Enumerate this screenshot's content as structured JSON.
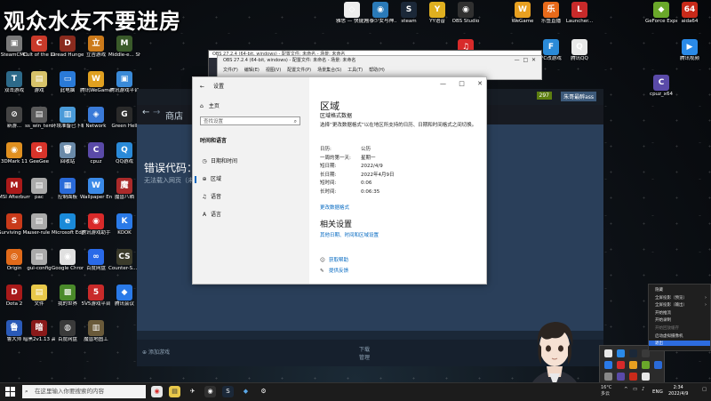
{
  "overlay": {
    "title": "观众水友不要进房"
  },
  "desktop_left": [
    {
      "label": "SteamCMD",
      "color": "#7a7a7a",
      "glyph": "▣"
    },
    {
      "label": "Cult of the Lamb 1.1.13 ...",
      "color": "#c93a2a",
      "glyph": "C"
    },
    {
      "label": "Dread Hunger",
      "color": "#8a2b1e",
      "glyph": "D"
    },
    {
      "label": "立吉游戏",
      "color": "#cc7a1a",
      "glyph": "立"
    },
    {
      "label": "Middle-e... Shadow of...",
      "color": "#3a5a2a",
      "glyph": "M"
    },
    {
      "label": "双击游戏",
      "color": "#2d6a8a",
      "glyph": "T"
    },
    {
      "label": "游戏",
      "color": "#d8c36a",
      "glyph": "▤"
    },
    {
      "label": "此电脑",
      "color": "#2a7ad8",
      "glyph": "▭"
    },
    {
      "label": "腾讯WeGame",
      "color": "#e0a020",
      "glyph": "W"
    },
    {
      "label": "腾讯游戏平台",
      "color": "#3a8ad8",
      "glyph": "▣"
    },
    {
      "label": "新游...",
      "color": "#444",
      "glyph": "⊘"
    },
    {
      "label": "ss_win_tem",
      "color": "#5a5a5a",
      "glyph": "▤"
    },
    {
      "label": "环境准备已下载的...",
      "color": "#4a9ad8",
      "glyph": "▥"
    },
    {
      "label": "Network",
      "color": "#3a7ad8",
      "glyph": "◈"
    },
    {
      "label": "Green Hell",
      "color": "#2a2a2a",
      "glyph": "G"
    },
    {
      "label": "3DMark 11",
      "color": "#e09020",
      "glyph": "◉"
    },
    {
      "label": "GeeGee",
      "color": "#d8342a",
      "glyph": "G"
    },
    {
      "label": "回收站",
      "color": "#6a8aa8",
      "glyph": "🗑"
    },
    {
      "label": "cpuz",
      "color": "#5a4aa8",
      "glyph": "C"
    },
    {
      "label": "QQ游戏",
      "color": "#2a8ad8",
      "glyph": "Q"
    },
    {
      "label": "MSI Afterburner",
      "color": "#aa1a1a",
      "glyph": "M"
    },
    {
      "label": "pac",
      "color": "#aaaaaa",
      "glyph": "▤"
    },
    {
      "label": "控制面板",
      "color": "#2a6ad8",
      "glyph": "▦"
    },
    {
      "label": "Wallpaper Engine",
      "color": "#3a8ae8",
      "glyph": "W"
    },
    {
      "label": "魔兽八晒",
      "color": "#aa2a2a",
      "glyph": "魔"
    },
    {
      "label": "Surviving Mars",
      "color": "#c83a1a",
      "glyph": "S"
    },
    {
      "label": "user-rule",
      "color": "#aaaaaa",
      "glyph": "▤"
    },
    {
      "label": "Microsoft Edge",
      "color": "#1a8ad8",
      "glyph": "e"
    },
    {
      "label": "腾讯游戏助手",
      "color": "#d82a2a",
      "glyph": "◉"
    },
    {
      "label": "KOOK",
      "color": "#2a7ae8",
      "glyph": "K"
    },
    {
      "label": "Origin",
      "color": "#e06a1a",
      "glyph": "◎"
    },
    {
      "label": "gui-config",
      "color": "#aaaaaa",
      "glyph": "▤"
    },
    {
      "label": "Google Chrome",
      "color": "#e0e0e0",
      "glyph": "◉"
    },
    {
      "label": "百度网盘",
      "color": "#2a6ae8",
      "glyph": "∞"
    },
    {
      "label": "Counter-S... Global Off...",
      "color": "#3a3a2a",
      "glyph": "CS"
    },
    {
      "label": "Dota 2",
      "color": "#a81a1a",
      "glyph": "D"
    },
    {
      "label": "文件",
      "color": "#e8c84a",
      "glyph": "▤"
    },
    {
      "label": "我的世界",
      "color": "#4a8a2a",
      "glyph": "▩"
    },
    {
      "label": "5V5游戏平台",
      "color": "#c82a2a",
      "glyph": "5"
    },
    {
      "label": "腾讯会议",
      "color": "#2a7ae8",
      "glyph": "◆"
    },
    {
      "label": "鲁大师",
      "color": "#2a5ab8",
      "glyph": "鲁"
    },
    {
      "label": "暗黑2v1.13 高清全屏",
      "color": "#8a1a1a",
      "glyph": "暗"
    },
    {
      "label": "百度网盘",
      "color": "#3a3a3a",
      "glyph": "◍"
    },
    {
      "label": "魔兽地图工",
      "color": "#6a5a3a",
      "glyph": "▥"
    }
  ],
  "desktop_top": [
    {
      "label": "雅思 — 快捷方式",
      "color": "#eeeeee",
      "glyph": "◇"
    },
    {
      "label": "阿泰少女与神...",
      "color": "#2a7ab8",
      "glyph": "◉"
    },
    {
      "label": "steam",
      "color": "#1b2838",
      "glyph": "S"
    },
    {
      "label": "YY语音",
      "color": "#e0b020",
      "glyph": "Y"
    },
    {
      "label": "OBS Studio",
      "color": "#303030",
      "glyph": "◉"
    },
    {
      "label": "网易云音乐",
      "color": "#d82a2a",
      "glyph": "♫"
    }
  ],
  "desktop_right": [
    {
      "label": "WeGame",
      "color": "#e8a020",
      "glyph": "W"
    },
    {
      "label": "乐鱼直播",
      "color": "#e86a1a",
      "glyph": "乐"
    },
    {
      "label": "Launcher...",
      "color": "#c82a2a",
      "glyph": "L"
    },
    {
      "label": "GeForce Experience",
      "color": "#6aa82a",
      "glyph": "◆"
    },
    {
      "label": "aida64",
      "color": "#c82a1a",
      "glyph": "64"
    },
    {
      "label": "FC改游戏",
      "color": "#2a8ad8",
      "glyph": "F"
    },
    {
      "label": "腾讯QQ",
      "color": "#e8e8e8",
      "glyph": "Q"
    },
    {
      "label": "腾讯视频",
      "color": "#2a8ae8",
      "glyph": "▶"
    },
    {
      "label": "cpuz_x64",
      "color": "#5a4aa8",
      "glyph": "C"
    }
  ],
  "steam": {
    "nav_title": "商店",
    "error_title": "错误代码：",
    "error_detail": "无法载入网页（未",
    "footer_add": "添加游戏",
    "footer_download": "下载",
    "footer_download_sub": "管理",
    "top_badge": "297",
    "top_user": "朱哥最醉ass"
  },
  "obs": {
    "title_back": "OBS 27.2.4 (64-bit, windows) - 配置文件: 未命名 - 场景: 未命名",
    "title_front": "OBS 27.2.4 (64-bit, windows) - 配置文件: 未命名 - 场景: 未命名",
    "menu": [
      "文件(F)",
      "编辑(E)",
      "视图(V)",
      "配置文件(P)",
      "场景集合(S)",
      "工具(T)",
      "帮助(H)"
    ]
  },
  "settings": {
    "window_title": "设置",
    "home": "主页",
    "search_placeholder": "查找设置",
    "category": "时间和语言",
    "nav": [
      {
        "label": "日期和时间",
        "icon": "◷"
      },
      {
        "label": "区域",
        "icon": "⊕"
      },
      {
        "label": "语音",
        "icon": "♫"
      },
      {
        "label": "语言",
        "icon": "A"
      }
    ],
    "region_title": "区域",
    "region_sub": "区域格式数据",
    "region_desc": "选择“更改数据格式”以在地区所支持的日历、日期和时间格式之间切换。",
    "rows": [
      {
        "k": "日历:",
        "v": "公历"
      },
      {
        "k": "一周的第一天:",
        "v": "星期一"
      },
      {
        "k": "短日期:",
        "v": "2022/4/9"
      },
      {
        "k": "长日期:",
        "v": "2022年4月9日"
      },
      {
        "k": "短时间:",
        "v": "0:06"
      },
      {
        "k": "长时间:",
        "v": "0:06:35"
      }
    ],
    "change_format": "更改数据格式",
    "related": "相关设置",
    "related_link": "其他日期、时间和区域设置",
    "get_help": "获取帮助",
    "feedback": "提供反馈"
  },
  "context_menu": {
    "items": [
      {
        "label": "隐藏",
        "state": "normal",
        "arrow": ""
      },
      {
        "label": "全屏投影（预览）",
        "state": "normal",
        "arrow": "›"
      },
      {
        "label": "全屏投影（输出）",
        "state": "normal",
        "arrow": "›"
      },
      {
        "label": "开始推流",
        "state": "normal",
        "arrow": ""
      },
      {
        "label": "开始录制",
        "state": "normal",
        "arrow": ""
      },
      {
        "label": "开始回放缓存",
        "state": "dim",
        "arrow": ""
      },
      {
        "label": "启动虚拟摄像机",
        "state": "normal",
        "arrow": ""
      },
      {
        "label": "退出",
        "state": "selected",
        "arrow": ""
      }
    ]
  },
  "taskbar": {
    "search_placeholder": "在这里输入你要搜索的内容",
    "weather_temp": "16°C",
    "weather_text": "多云",
    "lang": "ENG",
    "time": "2:34",
    "date": "2022/4/9"
  },
  "colors": {
    "accent": "#0067c0",
    "steam_bg": "#1b2838",
    "menu_selected": "#2d6cdf"
  }
}
